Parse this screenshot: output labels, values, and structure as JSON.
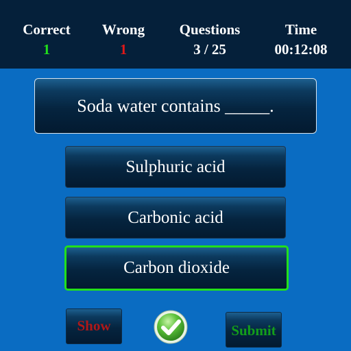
{
  "stats": {
    "correct": {
      "label": "Correct",
      "value": "1",
      "color": "#22e01c"
    },
    "wrong": {
      "label": "Wrong",
      "value": "1",
      "color": "#e01818"
    },
    "questions": {
      "label": "Questions",
      "value": "3 / 25"
    },
    "time": {
      "label": "Time",
      "value": "00:12:08"
    }
  },
  "question": {
    "text": "Soda water contains _____."
  },
  "answers": [
    {
      "label": "Sulphuric acid",
      "selected": false
    },
    {
      "label": "Carbonic acid",
      "selected": false
    },
    {
      "label": "Carbon dioxide",
      "selected": true
    }
  ],
  "controls": {
    "show_label": "Show",
    "submit_label": "Submit",
    "check_icon": "check-icon"
  },
  "colors": {
    "background": "#0a6cc2",
    "header": "#05203a",
    "selected_border": "#22e01c",
    "show_text": "#b01818",
    "submit_text": "#139e1a"
  }
}
